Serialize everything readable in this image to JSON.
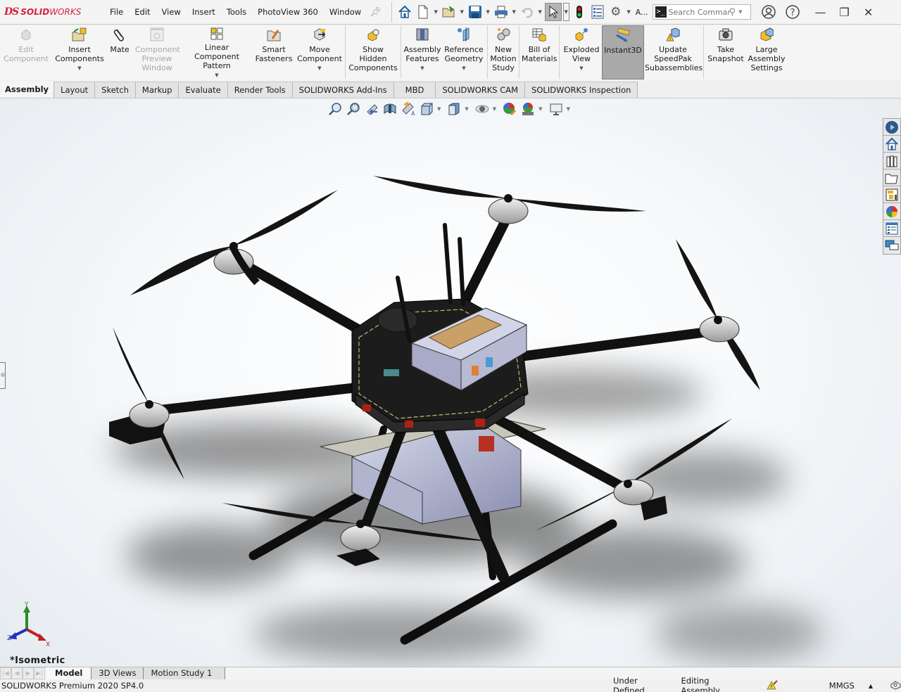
{
  "app": {
    "brand_ds": "DS",
    "brand_solid": "SOLID",
    "brand_works": "WORKS"
  },
  "menu": [
    "File",
    "Edit",
    "View",
    "Insert",
    "Tools",
    "PhotoView 360",
    "Window"
  ],
  "quick_access": {
    "icons": [
      "home-icon",
      "new-document-icon",
      "open-icon",
      "save-icon",
      "print-icon",
      "undo-icon",
      "select-icon",
      "rebuild-icon",
      "file-properties-icon",
      "options-icon"
    ],
    "overflow_label": "A...",
    "search_placeholder": "Search Commands"
  },
  "command_manager": {
    "commands": [
      {
        "label": "Edit Component",
        "icon": "edit-component-icon",
        "enabled": false,
        "has_dropdown": false
      },
      {
        "label": "Insert Components",
        "icon": "insert-components-icon",
        "enabled": true,
        "has_dropdown": true
      },
      {
        "label": "Mate",
        "icon": "mate-paperclip-icon",
        "enabled": true,
        "has_dropdown": false
      },
      {
        "label": "Component Preview Window",
        "icon": "component-preview-icon",
        "enabled": false,
        "has_dropdown": false
      },
      {
        "label": "Linear Component Pattern",
        "icon": "linear-pattern-icon",
        "enabled": true,
        "has_dropdown": true
      },
      {
        "label": "Smart Fasteners",
        "icon": "smart-fasteners-icon",
        "enabled": true,
        "has_dropdown": false
      },
      {
        "label": "Move Component",
        "icon": "move-component-icon",
        "enabled": true,
        "has_dropdown": true
      },
      {
        "label": "Show Hidden Components",
        "icon": "show-hidden-icon",
        "enabled": true,
        "has_dropdown": false
      },
      {
        "label": "Assembly Features",
        "icon": "assembly-features-icon",
        "enabled": true,
        "has_dropdown": true
      },
      {
        "label": "Reference Geometry",
        "icon": "reference-geometry-icon",
        "enabled": true,
        "has_dropdown": true
      },
      {
        "label": "New Motion Study",
        "icon": "motion-study-icon",
        "enabled": true,
        "has_dropdown": false
      },
      {
        "label": "Bill of Materials",
        "icon": "bom-icon",
        "enabled": true,
        "has_dropdown": false
      },
      {
        "label": "Exploded View",
        "icon": "exploded-view-icon",
        "enabled": true,
        "has_dropdown": true
      },
      {
        "label": "Instant3D",
        "icon": "instant3d-icon",
        "enabled": true,
        "has_dropdown": false,
        "active": true
      },
      {
        "label": "Update SpeedPak Subassemblies",
        "icon": "speedpak-icon",
        "enabled": true,
        "has_dropdown": false
      },
      {
        "label": "Take Snapshot",
        "icon": "camera-icon",
        "enabled": true,
        "has_dropdown": false
      },
      {
        "label": "Large Assembly Settings",
        "icon": "large-assembly-icon",
        "enabled": true,
        "has_dropdown": false
      }
    ]
  },
  "command_tabs": [
    "Assembly",
    "Layout",
    "Sketch",
    "Markup",
    "Evaluate",
    "Render Tools",
    "SOLIDWORKS Add-Ins",
    "MBD",
    "SOLIDWORKS CAM",
    "SOLIDWORKS Inspection"
  ],
  "active_command_tab": "Assembly",
  "heads_up_toolbar": [
    "zoom-to-fit-icon",
    "zoom-to-area-icon",
    "previous-view-icon",
    "section-view-icon",
    "dynamic-annotation-icon",
    "view-orientation-icon",
    "display-style-icon",
    "hide-show-icon",
    "edit-appearance-icon",
    "apply-scene-icon",
    "view-settings-icon"
  ],
  "task_pane": [
    "solidworks-resources-icon",
    "home-icon",
    "design-library-icon",
    "file-explorer-icon",
    "view-palette-icon",
    "appearances-icon",
    "custom-properties-icon",
    "forum-icon"
  ],
  "viewport": {
    "view_name": "*Isometric",
    "triad": {
      "x": "X",
      "y": "Y",
      "z": "Z"
    }
  },
  "bottom_tabs": [
    "Model",
    "3D Views",
    "Motion Study 1"
  ],
  "active_bottom_tab": "Model",
  "status": {
    "product": "SOLIDWORKS Premium 2020 SP4.0",
    "definition": "Under Defined",
    "mode": "Editing Assembly",
    "units": "MMGS"
  }
}
